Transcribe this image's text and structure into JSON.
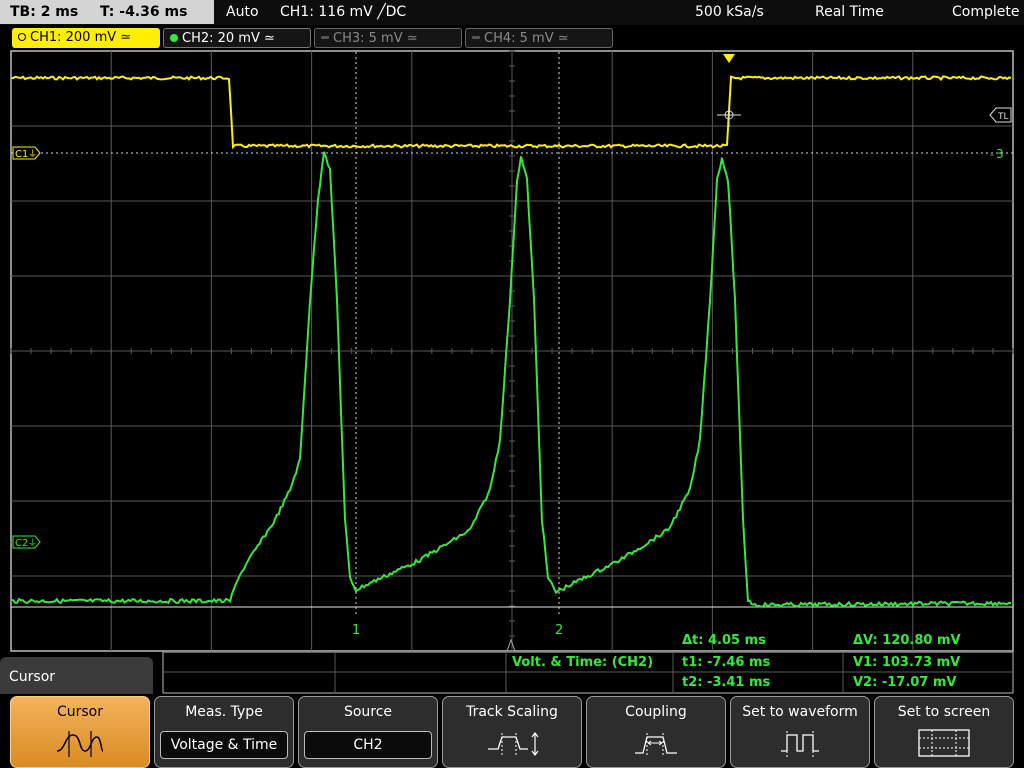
{
  "topbar": {
    "timebase": "TB: 2 ms",
    "trigger_time": "T: -4.36 ms",
    "trigger_mode": "Auto",
    "trigger_info": "CH1: 116 mV ╱DC",
    "sample_rate": "500 kSa/s",
    "acq_mode": "Real Time",
    "acq_status": "Complete"
  },
  "channels": [
    {
      "label": "CH1: 200 mV ≃",
      "state": "active",
      "color": "#ffee00"
    },
    {
      "label": "CH2: 20 mV ≃",
      "state": "on",
      "color": "#36e83c"
    },
    {
      "label": "CH3: 5 mV ≃",
      "state": "off",
      "color": "#8a8a8a"
    },
    {
      "label": "CH4: 5 mV ≃",
      "state": "off",
      "color": "#8a8a8a"
    }
  ],
  "screen_markers": {
    "ch1_offset": "C1",
    "ch2_offset": "C2",
    "trigger_level": "TL",
    "ch1_trigger_ref": "3",
    "cursor1": "1",
    "cursor2": "2"
  },
  "measurement": {
    "source_label": "Volt. & Time:  (CH2)",
    "dt": "Δt: 4.05 ms",
    "t1": "t1: -7.46 ms",
    "t2": "t2: -3.41 ms",
    "dv": "ΔV: 120.80 mV",
    "v1": "V1: 103.73 mV",
    "v2": "V2: -17.07 mV"
  },
  "menu": {
    "title": "Cursor",
    "softkeys": [
      {
        "title": "Cursor",
        "icon": "cursor-waveform-icon"
      },
      {
        "title": "Meas. Type",
        "value": "Voltage & Time"
      },
      {
        "title": "Source",
        "value": "CH2"
      },
      {
        "title": "Track Scaling",
        "icon": "track-scaling-icon"
      },
      {
        "title": "Coupling",
        "icon": "coupling-icon"
      },
      {
        "title": "Set to waveform",
        "icon": "set-to-waveform-icon"
      },
      {
        "title": "Set to screen",
        "icon": "set-to-screen-icon"
      }
    ]
  },
  "colors": {
    "ch1": "#ffee00",
    "ch2": "#36e83c",
    "grid": "#5a5a5a",
    "accent": "#f0a030"
  }
}
